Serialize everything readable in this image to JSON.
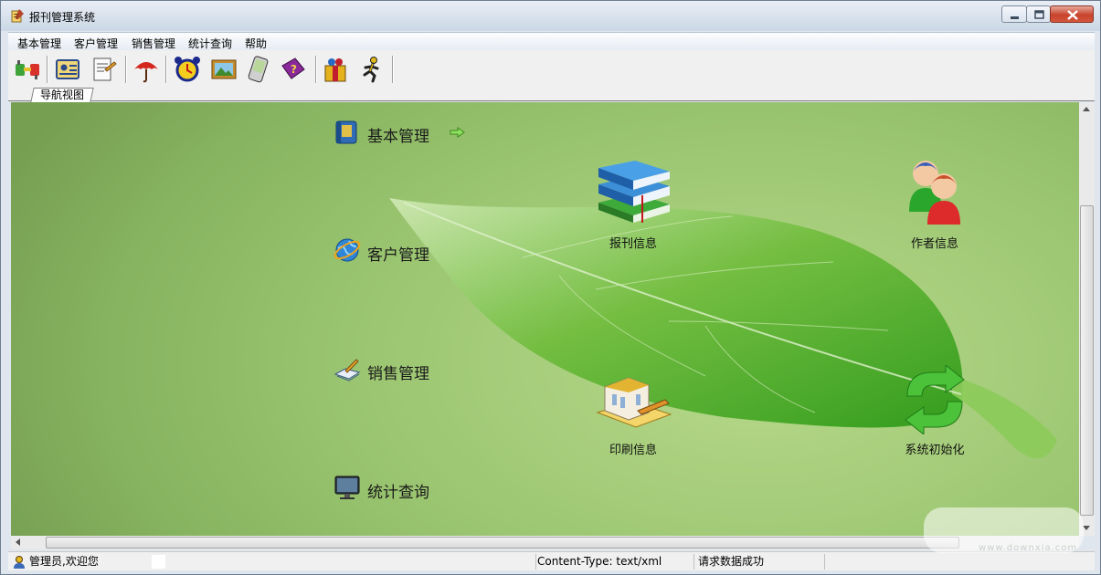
{
  "window": {
    "title": "报刊管理系统"
  },
  "menu": [
    "基本管理",
    "客户管理",
    "销售管理",
    "统计查询",
    "帮助"
  ],
  "toolbar": {
    "buttons": [
      "connect-icon",
      "customer-card-icon",
      "document-icon",
      "umbrella-icon",
      "alarm-clock-icon",
      "picture-icon",
      "pda-icon",
      "help-book-icon",
      "gift-icon",
      "runner-icon"
    ]
  },
  "tab": {
    "label": "导航视图"
  },
  "nav": [
    {
      "label": "基本管理",
      "icon": "book-box-icon"
    },
    {
      "label": "客户管理",
      "icon": "globe-icon"
    },
    {
      "label": "销售管理",
      "icon": "pen-pad-icon"
    },
    {
      "label": "统计查询",
      "icon": "monitor-icon"
    }
  ],
  "tiles": [
    {
      "label": "报刊信息",
      "icon": "books-icon"
    },
    {
      "label": "作者信息",
      "icon": "users-icon"
    },
    {
      "label": "印刷信息",
      "icon": "printing-house-icon"
    },
    {
      "label": "系统初始化",
      "icon": "refresh-icon"
    }
  ],
  "status": {
    "user": "管理员,欢迎您",
    "content_type": "Content-Type: text/xml",
    "message": "请求数据成功"
  },
  "watermark": "www.downxia.com",
  "colors": {
    "accent": "#8dc063",
    "leaf": "#4aa81f",
    "title_bar": "#d6e0ec"
  }
}
